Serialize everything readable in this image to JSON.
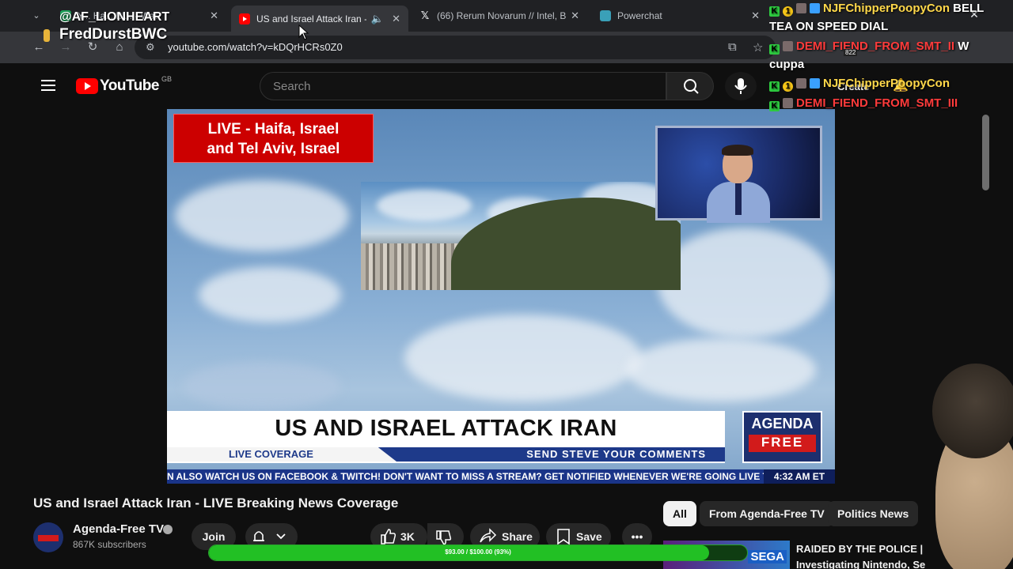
{
  "browser": {
    "tabs": [
      {
        "title": "Y... Ha... Bl... - Wat",
        "favicon": "green-square-icon"
      },
      {
        "title": "US and Israel Attack Iran - L",
        "favicon": "youtube-icon",
        "active": true
      },
      {
        "title": "(66) Rerum Novarum // Intel, Br",
        "favicon": "x-icon"
      },
      {
        "title": "Powerchat",
        "favicon": "powerchat-icon"
      }
    ],
    "url": "youtube.com/watch?v=kDQrHCRs0Z0"
  },
  "youtube": {
    "region": "GB",
    "logo_text": "YouTube",
    "search_placeholder": "Search",
    "create_label": "Create",
    "notification_count": "822"
  },
  "video": {
    "live_badge_line1": "LIVE - Haifa, Israel",
    "live_badge_line2": "and Tel Aviv, Israel",
    "headline": "US AND ISRAEL ATTACK IRAN",
    "live_coverage": "LIVE COVERAGE",
    "send_comments": "SEND STEVE YOUR COMMENTS",
    "logo_top": "AGENDA",
    "logo_bottom": "FREE",
    "ticker": "N ALSO WATCH US ON FACEBOOK & TWITCH!     DON'T WANT TO MISS A STREAM? GET NOTIFIED WHENEVER WE'RE GOING LIVE T",
    "clock": "4:32 AM ET"
  },
  "watch": {
    "title": "US and Israel Attack Iran - LIVE Breaking News Coverage",
    "channel_name": "Agenda-Free TV",
    "subscribers": "867K subscribers",
    "join_label": "Join",
    "likes": "3K",
    "share_label": "Share",
    "save_label": "Save"
  },
  "chips": [
    "All",
    "From Agenda-Free TV",
    "Politics News"
  ],
  "recommended": {
    "title_line1": "RAIDED BY THE POLICE |",
    "title_line2": "Investigating Nintendo, Se",
    "thumb_text": "SEGA"
  },
  "donation_bar": {
    "text": "$93.00 / $100.00 (93%)",
    "fraction": 0.93
  },
  "overlay": {
    "handle": "@AF_LIONHEART",
    "name": "FredDurstBWC",
    "chat": [
      {
        "user": "NJFChipperPoopyCon",
        "message": "BELL",
        "color": "#ffd84a"
      },
      {
        "user": "",
        "message": "TEA ON SPEED DIAL",
        "color": "#ffffff"
      },
      {
        "user": "DEMI_FIEND_FROM_SMT_II",
        "message": "W",
        "color": "#ff3b3b"
      },
      {
        "user": "",
        "message": "cuppa",
        "color": "#ffffff"
      },
      {
        "user": "NJFChipperPoopyCon",
        "message": "",
        "color": "#ffd84a"
      },
      {
        "user": "DEMI_FIEND_FROM_SMT_III",
        "message": "",
        "color": "#ff3b3b"
      }
    ]
  }
}
